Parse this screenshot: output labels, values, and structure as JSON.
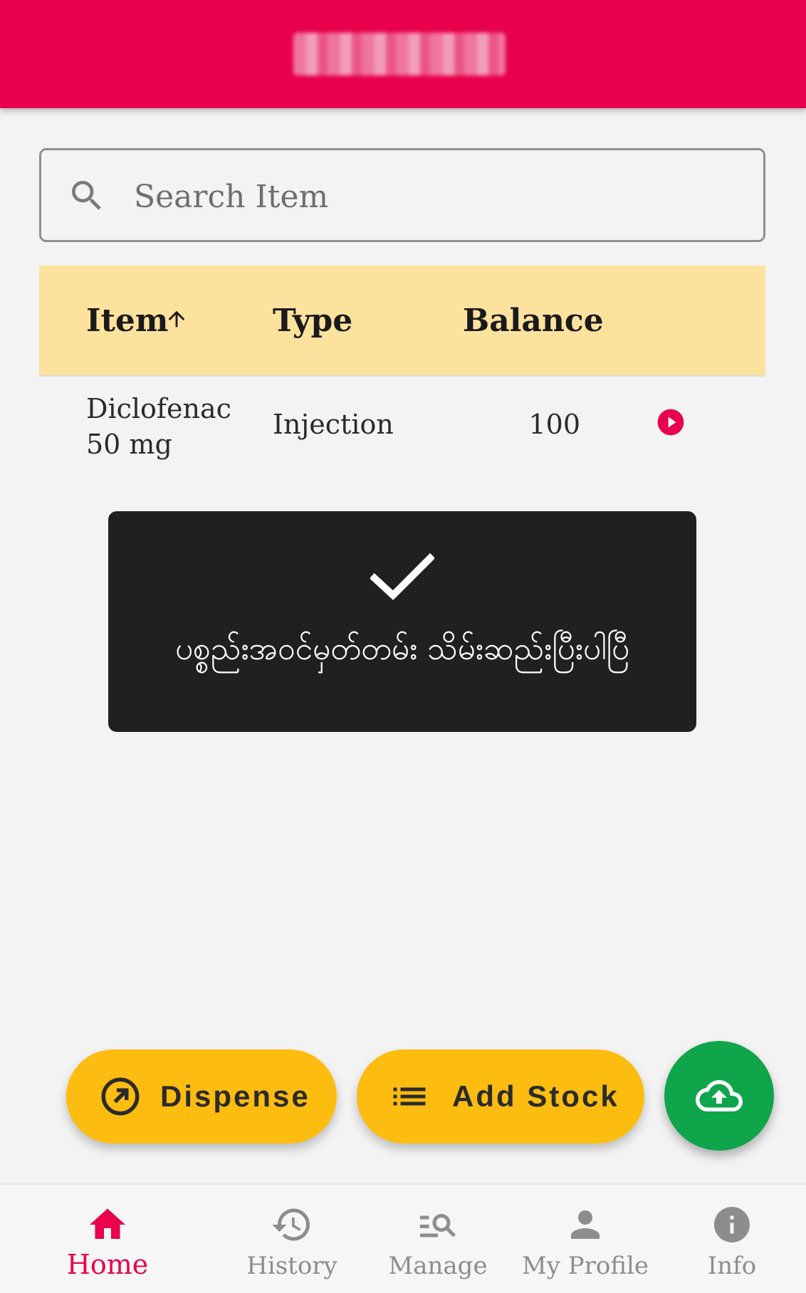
{
  "search": {
    "placeholder": "Search Item"
  },
  "table": {
    "columns": [
      "Item",
      "Type",
      "Balance"
    ],
    "rows": [
      {
        "item_line1": "Diclofenac",
        "item_line2": "50 mg",
        "type": "Injection",
        "balance": "100"
      }
    ]
  },
  "toast": {
    "message": "ပစ္စည်းအဝင်မှတ်တမ်း သိမ်းဆည်းပြီးပါပြီ"
  },
  "actions": {
    "dispense_label": "Dispense",
    "add_stock_label": "Add Stock"
  },
  "nav": {
    "home": "Home",
    "history": "History",
    "manage": "Manage",
    "profile": "My Profile",
    "info": "Info"
  },
  "colors": {
    "primary": "#e8004c",
    "header_row": "#fde29d",
    "action_yellow": "#fdbc10",
    "fab_green": "#0fa54a",
    "toast_bg": "#202020"
  },
  "icons": [
    "search-icon",
    "sort-up-icon",
    "play-circle-icon",
    "checkmark-icon",
    "arrow-up-right-circle-icon",
    "list-icon",
    "cloud-upload-icon",
    "home-icon",
    "history-icon",
    "manage-search-icon",
    "person-icon",
    "info-icon"
  ]
}
